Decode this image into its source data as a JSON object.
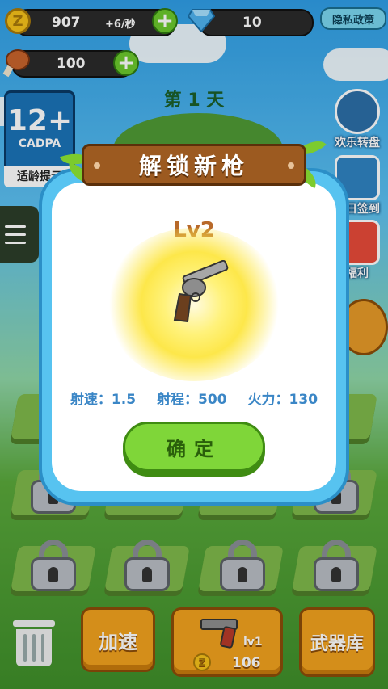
{
  "hud": {
    "coins": "907",
    "coin_rate": "+6/秒",
    "gems": "10",
    "food": "100",
    "privacy_label": "隐私政策"
  },
  "day_label": "第 1 天",
  "age_rating": {
    "rating": "12+",
    "org": "CADPA",
    "label": "适龄提示"
  },
  "side_menu": {
    "items": [
      {
        "label": "欢乐转盘"
      },
      {
        "label": "每日签到"
      },
      {
        "label": "福利"
      }
    ]
  },
  "modal": {
    "title": "解锁新枪",
    "level": "Lv2",
    "stats": {
      "fire_rate": "射速：1.5",
      "range": "射程：500",
      "firepower": "火力：130"
    },
    "confirm_label": "确定"
  },
  "bottom_bar": {
    "speed_label": "加速",
    "buy_level": "lv1",
    "buy_price": "106",
    "armory_label": "武器库"
  },
  "colors": {
    "sky": "#2f9ee6",
    "grass": "#5aa93b",
    "modal_frame": "#57c3f0",
    "banner": "#9c5a20",
    "confirm": "#7fd639",
    "orange_button": "#f2a21e"
  }
}
